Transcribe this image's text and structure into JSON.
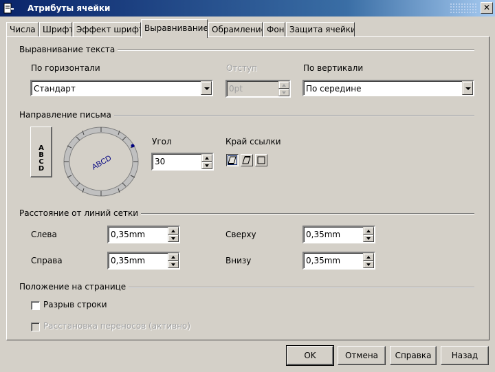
{
  "window": {
    "title": "Атрибуты ячейки",
    "app_icon": "document-icon",
    "close_label": "✕"
  },
  "tabs": [
    {
      "label": "Числа",
      "active": false
    },
    {
      "label": "Шрифт",
      "active": false
    },
    {
      "label": "Эффект шрифта",
      "active": false
    },
    {
      "label": "Выравнивание",
      "active": true
    },
    {
      "label": "Обрамление",
      "active": false
    },
    {
      "label": "Фон",
      "active": false
    },
    {
      "label": "Защита ячейки",
      "active": false
    }
  ],
  "text_alignment": {
    "section_title": "Выравнивание текста",
    "horizontal_label": "По горизонтали",
    "horizontal_value": "Стандарт",
    "indent_label": "Отступ",
    "indent_value": "0pt",
    "vertical_label": "По вертикали",
    "vertical_value": "По середине"
  },
  "text_direction": {
    "section_title": "Направление письма",
    "vertical_stack_text": "ABCD",
    "dial_text": "ABCD",
    "angle_label": "Угол",
    "angle_value": "30",
    "ref_edge_label": "Край ссылки",
    "accent": "#000080"
  },
  "grid_spacing": {
    "section_title": "Расстояние от линий сетки",
    "left_label": "Слева",
    "left_value": "0,35mm",
    "right_label": "Справа",
    "right_value": "0,35mm",
    "top_label": "Сверху",
    "top_value": "0,35mm",
    "bottom_label": "Внизу",
    "bottom_value": "0,35mm"
  },
  "page_position": {
    "section_title": "Положение на странице",
    "wrap_label": "Разрыв строки",
    "wrap_checked": false,
    "hyphen_label": "Расстановка переносов (активно)",
    "hyphen_checked": false
  },
  "buttons": {
    "ok": "OK",
    "cancel": "Отмена",
    "help": "Справка",
    "back": "Назад"
  }
}
